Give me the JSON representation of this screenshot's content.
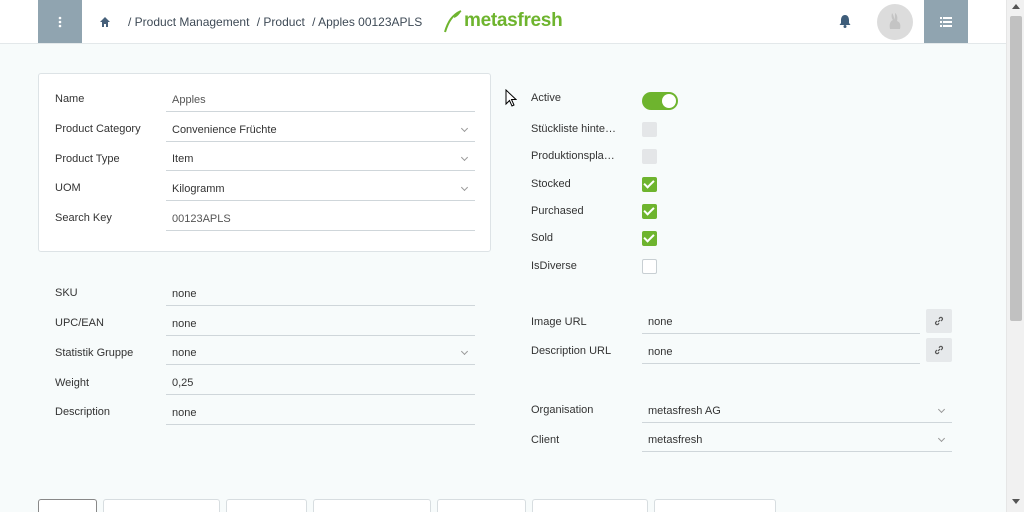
{
  "header": {
    "breadcrumb": [
      "/ Product Management",
      "/ Product",
      "/ Apples 00123APLS"
    ],
    "logo_text": "metasfresh"
  },
  "left_form": {
    "name": {
      "label": "Name",
      "value": "Apples"
    },
    "product_category": {
      "label": "Product Category",
      "value": "Convenience Früchte"
    },
    "product_type": {
      "label": "Product Type",
      "value": "Item"
    },
    "uom": {
      "label": "UOM",
      "value": "Kilogramm"
    },
    "search_key": {
      "label": "Search Key",
      "value": "00123APLS"
    },
    "sku": {
      "label": "SKU",
      "value": "none"
    },
    "upc_ean": {
      "label": "UPC/EAN",
      "value": "none"
    },
    "statistik_gruppe": {
      "label": "Statistik Gruppe",
      "value": "none"
    },
    "weight": {
      "label": "Weight",
      "value": "0,25"
    },
    "description": {
      "label": "Description",
      "value": "none"
    }
  },
  "right_form": {
    "active": {
      "label": "Active",
      "checked": true
    },
    "stueckliste": {
      "label": "Stückliste hinte…",
      "checked": false,
      "disabled": true
    },
    "produktionsplan": {
      "label": "Produktionspla…",
      "checked": false,
      "disabled": true
    },
    "stocked": {
      "label": "Stocked",
      "checked": true
    },
    "purchased": {
      "label": "Purchased",
      "checked": true
    },
    "sold": {
      "label": "Sold",
      "checked": true
    },
    "isdiverse": {
      "label": "IsDiverse",
      "checked": false
    },
    "image_url": {
      "label": "Image URL",
      "value": "none"
    },
    "description_url": {
      "label": "Description URL",
      "value": "none"
    },
    "organisation": {
      "label": "Organisation",
      "value": "metasfresh AG"
    },
    "client": {
      "label": "Client",
      "value": "metasfresh"
    }
  },
  "colors": {
    "accent_green": "#6eb42e",
    "header_button": "#90a4b0"
  }
}
